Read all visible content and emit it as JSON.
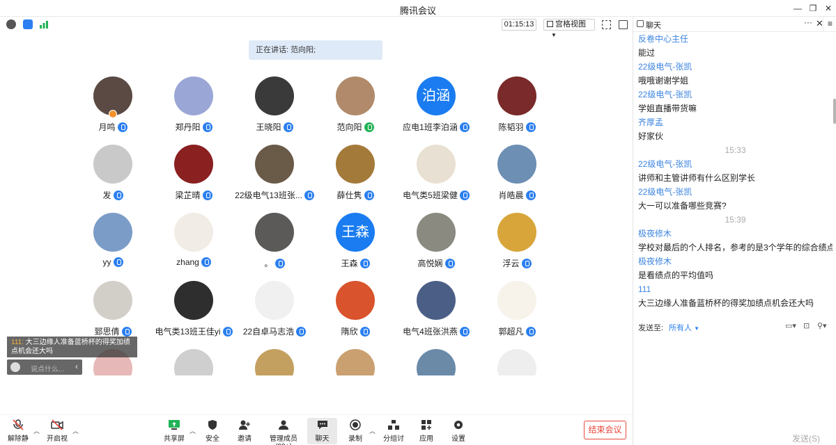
{
  "window": {
    "title": "腾讯会议"
  },
  "topbar": {
    "timer": "01:15:13",
    "view_label": "宫格视图"
  },
  "speaking": {
    "label": "正在讲话: 范向阳;"
  },
  "participants": [
    {
      "name": "月鸣",
      "initials": ""
    },
    {
      "name": "郑丹阳",
      "initials": ""
    },
    {
      "name": "王晓阳",
      "initials": ""
    },
    {
      "name": "范向阳",
      "initials": ""
    },
    {
      "name": "应电1班李泊涵",
      "initials": "泊涵"
    },
    {
      "name": "陈韬羽",
      "initials": ""
    },
    {
      "name": "发",
      "initials": ""
    },
    {
      "name": "梁芷晴",
      "initials": ""
    },
    {
      "name": "22级电气13班张...",
      "initials": ""
    },
    {
      "name": "薛仕隽",
      "initials": ""
    },
    {
      "name": "电气类5班梁健",
      "initials": ""
    },
    {
      "name": "肖皓晨",
      "initials": ""
    },
    {
      "name": "yy",
      "initials": ""
    },
    {
      "name": "zhang",
      "initials": ""
    },
    {
      "name": "。",
      "initials": ""
    },
    {
      "name": "王森",
      "initials": "王森"
    },
    {
      "name": "高悦娴",
      "initials": ""
    },
    {
      "name": "浮云",
      "initials": ""
    },
    {
      "name": "郅思倩",
      "initials": ""
    },
    {
      "name": "电气类13班王佳yi",
      "initials": ""
    },
    {
      "name": "22自卓马志浩",
      "initials": ""
    },
    {
      "name": "隋欣",
      "initials": ""
    },
    {
      "name": "电气4班张洪燕",
      "initials": ""
    },
    {
      "name": "郭超凡",
      "initials": ""
    },
    {
      "name": "",
      "initials": ""
    },
    {
      "name": "",
      "initials": ""
    },
    {
      "name": "",
      "initials": ""
    },
    {
      "name": "",
      "initials": ""
    },
    {
      "name": "",
      "initials": ""
    },
    {
      "name": "",
      "initials": ""
    }
  ],
  "toast": {
    "sender": "111:",
    "text": "大三边缘人准备蓝桥杯的得奖加绩点机会还大吗",
    "placeholder": "说点什么..."
  },
  "bottombar": {
    "mute": "解除静音",
    "video": "开启视频",
    "share": "共享屏幕",
    "security": "安全",
    "invite": "邀请",
    "members": "管理成员(99+)",
    "chat": "聊天",
    "record": "录制",
    "breakout": "分组讨论",
    "apps": "应用",
    "settings": "设置",
    "end": "结束会议"
  },
  "chat": {
    "title": "聊天",
    "messages": [
      {
        "kind": "name",
        "text": "反卷中心主任"
      },
      {
        "kind": "text",
        "text": "能过"
      },
      {
        "kind": "name",
        "text": "22级电气-张凯"
      },
      {
        "kind": "text",
        "text": "哦哦谢谢学姐"
      },
      {
        "kind": "name",
        "text": "22级电气-张凯"
      },
      {
        "kind": "text",
        "text": "学姐直播带货嘛"
      },
      {
        "kind": "name",
        "text": "齐厚孟"
      },
      {
        "kind": "text",
        "text": "好家伙"
      },
      {
        "kind": "time",
        "text": "15:33"
      },
      {
        "kind": "name",
        "text": "22级电气-张凯"
      },
      {
        "kind": "text",
        "text": "讲师和主管讲师有什么区别学长"
      },
      {
        "kind": "name",
        "text": "22级电气-张凯"
      },
      {
        "kind": "text",
        "text": "大一可以准备哪些竞赛?"
      },
      {
        "kind": "time",
        "text": "15:39"
      },
      {
        "kind": "name",
        "text": "极夜修木"
      },
      {
        "kind": "text",
        "text": "学校对最后的个人排名，参考的是3个学年的综合绩点吗"
      },
      {
        "kind": "name",
        "text": "极夜修木"
      },
      {
        "kind": "text",
        "text": "是看绩点的平均值吗"
      },
      {
        "kind": "name",
        "text": "111"
      },
      {
        "kind": "text",
        "text": "大三边缘人准备蓝桥杯的得奖加绩点机会还大吗"
      }
    ],
    "send_to_label": "发送至:",
    "send_to_value": "所有人",
    "send_button": "发送(S)"
  },
  "colors": {
    "accent": "#2b7ff0",
    "end": "#e9463a",
    "chat_name": "#3b84e0"
  }
}
